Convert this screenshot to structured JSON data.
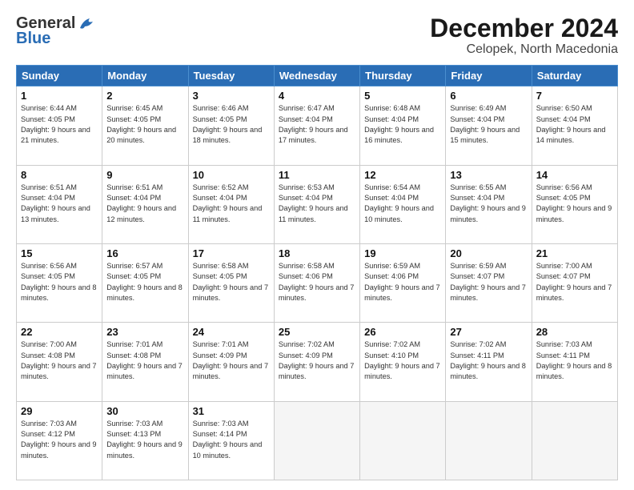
{
  "header": {
    "logo_general": "General",
    "logo_blue": "Blue",
    "month_title": "December 2024",
    "location": "Celopek, North Macedonia"
  },
  "weekdays": [
    "Sunday",
    "Monday",
    "Tuesday",
    "Wednesday",
    "Thursday",
    "Friday",
    "Saturday"
  ],
  "weeks": [
    [
      {
        "day": "1",
        "sunrise": "Sunrise: 6:44 AM",
        "sunset": "Sunset: 4:05 PM",
        "daylight": "Daylight: 9 hours and 21 minutes."
      },
      {
        "day": "2",
        "sunrise": "Sunrise: 6:45 AM",
        "sunset": "Sunset: 4:05 PM",
        "daylight": "Daylight: 9 hours and 20 minutes."
      },
      {
        "day": "3",
        "sunrise": "Sunrise: 6:46 AM",
        "sunset": "Sunset: 4:05 PM",
        "daylight": "Daylight: 9 hours and 18 minutes."
      },
      {
        "day": "4",
        "sunrise": "Sunrise: 6:47 AM",
        "sunset": "Sunset: 4:04 PM",
        "daylight": "Daylight: 9 hours and 17 minutes."
      },
      {
        "day": "5",
        "sunrise": "Sunrise: 6:48 AM",
        "sunset": "Sunset: 4:04 PM",
        "daylight": "Daylight: 9 hours and 16 minutes."
      },
      {
        "day": "6",
        "sunrise": "Sunrise: 6:49 AM",
        "sunset": "Sunset: 4:04 PM",
        "daylight": "Daylight: 9 hours and 15 minutes."
      },
      {
        "day": "7",
        "sunrise": "Sunrise: 6:50 AM",
        "sunset": "Sunset: 4:04 PM",
        "daylight": "Daylight: 9 hours and 14 minutes."
      }
    ],
    [
      {
        "day": "8",
        "sunrise": "Sunrise: 6:51 AM",
        "sunset": "Sunset: 4:04 PM",
        "daylight": "Daylight: 9 hours and 13 minutes."
      },
      {
        "day": "9",
        "sunrise": "Sunrise: 6:51 AM",
        "sunset": "Sunset: 4:04 PM",
        "daylight": "Daylight: 9 hours and 12 minutes."
      },
      {
        "day": "10",
        "sunrise": "Sunrise: 6:52 AM",
        "sunset": "Sunset: 4:04 PM",
        "daylight": "Daylight: 9 hours and 11 minutes."
      },
      {
        "day": "11",
        "sunrise": "Sunrise: 6:53 AM",
        "sunset": "Sunset: 4:04 PM",
        "daylight": "Daylight: 9 hours and 11 minutes."
      },
      {
        "day": "12",
        "sunrise": "Sunrise: 6:54 AM",
        "sunset": "Sunset: 4:04 PM",
        "daylight": "Daylight: 9 hours and 10 minutes."
      },
      {
        "day": "13",
        "sunrise": "Sunrise: 6:55 AM",
        "sunset": "Sunset: 4:04 PM",
        "daylight": "Daylight: 9 hours and 9 minutes."
      },
      {
        "day": "14",
        "sunrise": "Sunrise: 6:56 AM",
        "sunset": "Sunset: 4:05 PM",
        "daylight": "Daylight: 9 hours and 9 minutes."
      }
    ],
    [
      {
        "day": "15",
        "sunrise": "Sunrise: 6:56 AM",
        "sunset": "Sunset: 4:05 PM",
        "daylight": "Daylight: 9 hours and 8 minutes."
      },
      {
        "day": "16",
        "sunrise": "Sunrise: 6:57 AM",
        "sunset": "Sunset: 4:05 PM",
        "daylight": "Daylight: 9 hours and 8 minutes."
      },
      {
        "day": "17",
        "sunrise": "Sunrise: 6:58 AM",
        "sunset": "Sunset: 4:05 PM",
        "daylight": "Daylight: 9 hours and 7 minutes."
      },
      {
        "day": "18",
        "sunrise": "Sunrise: 6:58 AM",
        "sunset": "Sunset: 4:06 PM",
        "daylight": "Daylight: 9 hours and 7 minutes."
      },
      {
        "day": "19",
        "sunrise": "Sunrise: 6:59 AM",
        "sunset": "Sunset: 4:06 PM",
        "daylight": "Daylight: 9 hours and 7 minutes."
      },
      {
        "day": "20",
        "sunrise": "Sunrise: 6:59 AM",
        "sunset": "Sunset: 4:07 PM",
        "daylight": "Daylight: 9 hours and 7 minutes."
      },
      {
        "day": "21",
        "sunrise": "Sunrise: 7:00 AM",
        "sunset": "Sunset: 4:07 PM",
        "daylight": "Daylight: 9 hours and 7 minutes."
      }
    ],
    [
      {
        "day": "22",
        "sunrise": "Sunrise: 7:00 AM",
        "sunset": "Sunset: 4:08 PM",
        "daylight": "Daylight: 9 hours and 7 minutes."
      },
      {
        "day": "23",
        "sunrise": "Sunrise: 7:01 AM",
        "sunset": "Sunset: 4:08 PM",
        "daylight": "Daylight: 9 hours and 7 minutes."
      },
      {
        "day": "24",
        "sunrise": "Sunrise: 7:01 AM",
        "sunset": "Sunset: 4:09 PM",
        "daylight": "Daylight: 9 hours and 7 minutes."
      },
      {
        "day": "25",
        "sunrise": "Sunrise: 7:02 AM",
        "sunset": "Sunset: 4:09 PM",
        "daylight": "Daylight: 9 hours and 7 minutes."
      },
      {
        "day": "26",
        "sunrise": "Sunrise: 7:02 AM",
        "sunset": "Sunset: 4:10 PM",
        "daylight": "Daylight: 9 hours and 7 minutes."
      },
      {
        "day": "27",
        "sunrise": "Sunrise: 7:02 AM",
        "sunset": "Sunset: 4:11 PM",
        "daylight": "Daylight: 9 hours and 8 minutes."
      },
      {
        "day": "28",
        "sunrise": "Sunrise: 7:03 AM",
        "sunset": "Sunset: 4:11 PM",
        "daylight": "Daylight: 9 hours and 8 minutes."
      }
    ],
    [
      {
        "day": "29",
        "sunrise": "Sunrise: 7:03 AM",
        "sunset": "Sunset: 4:12 PM",
        "daylight": "Daylight: 9 hours and 9 minutes."
      },
      {
        "day": "30",
        "sunrise": "Sunrise: 7:03 AM",
        "sunset": "Sunset: 4:13 PM",
        "daylight": "Daylight: 9 hours and 9 minutes."
      },
      {
        "day": "31",
        "sunrise": "Sunrise: 7:03 AM",
        "sunset": "Sunset: 4:14 PM",
        "daylight": "Daylight: 9 hours and 10 minutes."
      },
      null,
      null,
      null,
      null
    ]
  ]
}
